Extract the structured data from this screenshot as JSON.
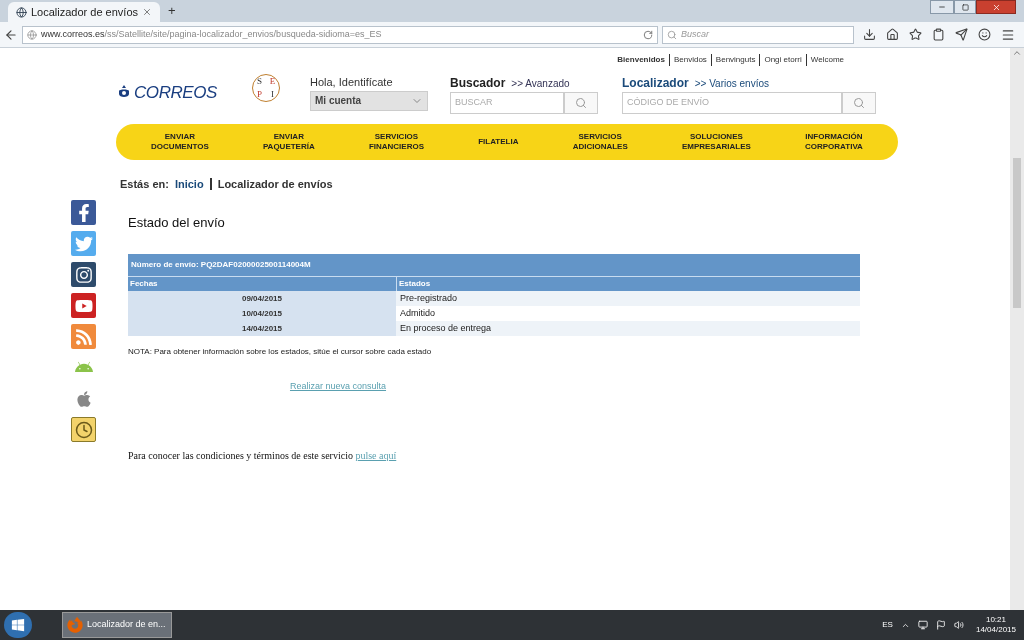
{
  "browser": {
    "tab_title": "Localizador de envíos",
    "new_tab": "+",
    "url_host": "www.correos.es",
    "url_path": "/ss/Satellite/site/pagina-localizador_envios/busqueda-sidioma=es_ES",
    "search_placeholder": "Buscar"
  },
  "languages": [
    {
      "label": "Bienvenidos",
      "selected": true
    },
    {
      "label": "Benvidos",
      "selected": false
    },
    {
      "label": "Benvinguts",
      "selected": false
    },
    {
      "label": "Ongi etorri",
      "selected": false
    },
    {
      "label": "Welcome",
      "selected": false
    }
  ],
  "header": {
    "logo": "CORREOS",
    "sepi_letters": [
      "S",
      "E",
      "P",
      "I"
    ],
    "greeting": "Hola, Identifícate",
    "account": "Mi cuenta",
    "search_title": "Buscador",
    "search_link": ">> Avanzado",
    "search_placeholder": "BUSCAR",
    "tracker_title": "Localizador",
    "tracker_link": ">> Varios envíos",
    "tracker_placeholder": "CÓDIGO DE ENVÍO"
  },
  "nav": [
    [
      "ENVIAR",
      "DOCUMENTOS"
    ],
    [
      "ENVIAR",
      "PAQUETERÍA"
    ],
    [
      "SERVICIOS",
      "FINANCIEROS"
    ],
    [
      "FILATELIA"
    ],
    [
      "SERVICIOS",
      "ADICIONALES"
    ],
    [
      "SOLUCIONES",
      "EMPRESARIALES"
    ],
    [
      "INFORMACIÓN",
      "CORPORATIVA"
    ]
  ],
  "breadcrumb": {
    "label": "Estás en:",
    "link": "Inicio",
    "current": "Localizador de envíos"
  },
  "social": [
    {
      "kind": "facebook"
    },
    {
      "kind": "twitter"
    },
    {
      "kind": "instagram"
    },
    {
      "kind": "youtube"
    },
    {
      "kind": "rss"
    },
    {
      "kind": "android"
    },
    {
      "kind": "apple"
    },
    {
      "kind": "clock"
    }
  ],
  "title": "Estado del envío",
  "table": {
    "caption": "Número de envío: PQ2DAF0200002500114004M",
    "columns": [
      "Fechas",
      "Estados"
    ],
    "rows": [
      [
        "09/04/2015",
        "Pre-registrado"
      ],
      [
        "10/04/2015",
        "Admitido"
      ],
      [
        "14/04/2015",
        "En proceso de entrega"
      ]
    ]
  },
  "note": "NOTA: Para obtener información sobre los estados, sitúe el cursor sobre cada estado",
  "new_query": "Realizar nueva consulta",
  "terms": {
    "text": "Para conocer las condiciones y términos de este servicio",
    "link": "pulse aquí"
  },
  "taskbar": {
    "window": "Localizador de en...",
    "lang": "ES",
    "time": "10:21",
    "date": "14/04/2015"
  }
}
